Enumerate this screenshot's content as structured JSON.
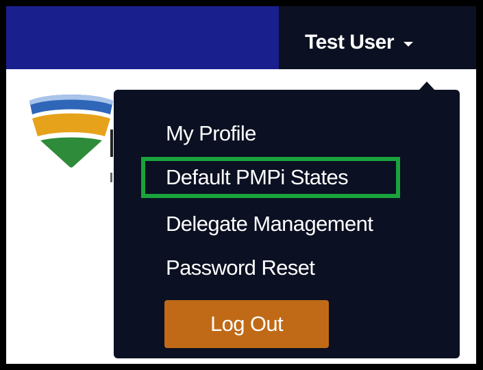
{
  "header": {
    "user_name": "Test User",
    "caret_icon": "caret-down-icon"
  },
  "user_menu": {
    "items": [
      {
        "label": "My Profile"
      },
      {
        "label": "Default PMPi States",
        "highlighted": true
      },
      {
        "label": "Delegate Management"
      },
      {
        "label": "Password Reset"
      }
    ],
    "logout_label": "Log Out"
  },
  "colors": {
    "header_bg": "#1a1f8e",
    "menu_bg": "#0b1022",
    "highlight": "#1aa33c",
    "logout_bg": "#c06a17"
  }
}
